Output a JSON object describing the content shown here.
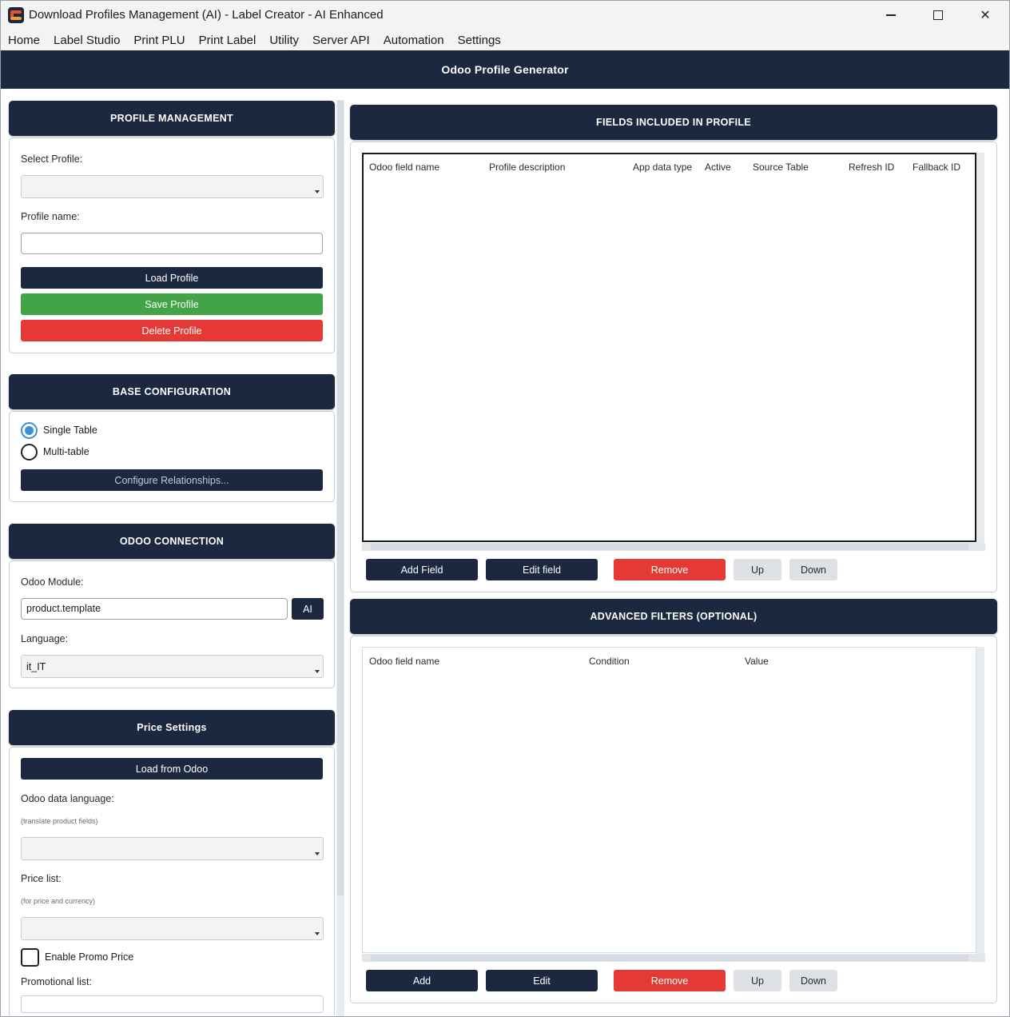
{
  "window": {
    "title": "Download Profiles Management (AI) - Label Creator - AI Enhanced",
    "minimize": "–",
    "maximize": "□",
    "close": "✕"
  },
  "menu": [
    "Home",
    "Label Studio",
    "Print PLU",
    "Print Label",
    "Utility",
    "Server API",
    "Automation",
    "Settings"
  ],
  "header": {
    "title": "Odoo Profile Generator"
  },
  "profile_management": {
    "title": "PROFILE MANAGEMENT",
    "select_label": "Select Profile:",
    "select_value": "",
    "name_label": "Profile name:",
    "name_value": "",
    "load_button": "Load Profile",
    "save_button": "Save Profile",
    "delete_button": "Delete Profile"
  },
  "base_configuration": {
    "title": "BASE CONFIGURATION",
    "option_single": "Single Table",
    "option_multi": "Multi-table",
    "selected": "Single Table",
    "configure_button": "Configure Relationships..."
  },
  "odoo_connection": {
    "title": "ODOO CONNECTION",
    "module_label": "Odoo Module:",
    "module_value": "product.template",
    "ai_button": "AI",
    "language_label": "Language:",
    "language_value": "it_IT"
  },
  "price_settings": {
    "title": "Price Settings",
    "load_button": "Load from Odoo",
    "data_language_label": "Odoo data language:",
    "data_language_hint": "(translate product fields)",
    "data_language_value": "",
    "price_list_label": "Price list:",
    "price_list_hint": "(for price and currency)",
    "price_list_value": "",
    "promo_checkbox": "Enable Promo Price",
    "promo_checked": false,
    "promo_list_label": "Promotional list:"
  },
  "fields_panel": {
    "title": "FIELDS INCLUDED IN PROFILE",
    "columns": [
      "Odoo field name",
      "Profile description",
      "App data type",
      "Active",
      "Source Table",
      "Refresh ID",
      "Fallback ID"
    ],
    "rows": [],
    "buttons": {
      "add": "Add Field",
      "edit": "Edit field",
      "remove": "Remove",
      "up": "Up",
      "down": "Down"
    }
  },
  "filters_panel": {
    "title": "ADVANCED FILTERS (OPTIONAL)",
    "columns": [
      "Odoo field name",
      "Condition",
      "Value"
    ],
    "rows": [],
    "buttons": {
      "add": "Add",
      "edit": "Edit",
      "remove": "Remove",
      "up": "Up",
      "down": "Down"
    }
  },
  "colors": {
    "navy": "#1c2740",
    "green": "#43a447",
    "red": "#e53935",
    "radio_accent": "#3d8fd6"
  }
}
